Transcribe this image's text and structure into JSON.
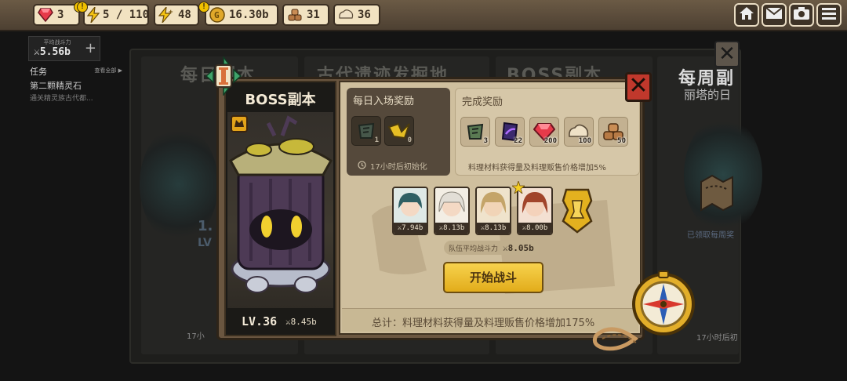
{
  "resources": [
    {
      "icon": "gem-icon",
      "value": "3",
      "alert": "!"
    },
    {
      "icon": "energy-icon",
      "value": "5 / 110",
      "alert": "!"
    },
    {
      "icon": "energy-plus-icon",
      "value": "48"
    },
    {
      "icon": "gold-coin-icon",
      "value": "16.30b",
      "alert": "!"
    },
    {
      "icon": "wood-icon",
      "value": "31"
    },
    {
      "icon": "stone-icon",
      "value": "36"
    }
  ],
  "top_buttons": [
    "home-icon",
    "mail-icon",
    "camera-icon",
    "menu-icon"
  ],
  "sidebar": {
    "power_label": "平均战斗力",
    "power_value": "⚔5.56b",
    "plus": "+",
    "quest_title": "任务",
    "quest_all": "查看全部 ▶",
    "quest_name": "第二颗精灵石",
    "quest_desc": "通关精灵族古代都..."
  },
  "background": {
    "tabs": [
      "每日副本",
      "古代遗迹发掘地",
      "BOSS副本"
    ],
    "weekly_title": "每周副",
    "weekly_sub": "丽塔的日",
    "level_text": "1.",
    "level_text2": "LV",
    "timer_left": "17小",
    "timer_right": "17小时后初",
    "claimed": "已领取每周奖"
  },
  "modal": {
    "boss_title": "BOSS副本",
    "boss_level": "LV.36",
    "boss_power": "⚔8.45b",
    "daily_title": "每日入场奖励",
    "daily_items": [
      {
        "icon": "leaf-scroll-icon",
        "count": "1"
      },
      {
        "icon": "gold-ticket-icon",
        "count": "0"
      }
    ],
    "daily_timer": "17小时后初始化",
    "finish_title": "完成奖励",
    "finish_items": [
      {
        "icon": "leaf-scroll-icon",
        "count": "3"
      },
      {
        "icon": "purple-crystal-icon",
        "count": "22"
      },
      {
        "icon": "red-gem-icon",
        "count": "200"
      },
      {
        "icon": "stone-icon",
        "count": "100"
      },
      {
        "icon": "wood-icon",
        "count": "50"
      }
    ],
    "finish_note": "料理材料获得量及料理贩售价格增加5%",
    "heroes": [
      {
        "power": "⚔7.94b",
        "hair": "#2f5f63",
        "skin": "#f4d9c4"
      },
      {
        "power": "⚔8.13b",
        "hair": "#e9e6e0",
        "skin": "#f4d9c4"
      },
      {
        "power": "⚔8.13b",
        "hair": "#c4a469",
        "skin": "#f1d4b7"
      },
      {
        "power": "⚔8.00b",
        "hair": "#a1442a",
        "skin": "#f4d2bb"
      }
    ],
    "team_power_label": "队伍平均战斗力",
    "team_power_value": "⚔8.05b",
    "start_button": "开始战斗",
    "total_text": "总计：料理材料获得量及料理贩售价格增加175%"
  },
  "colors": {
    "accent": "#f0c000",
    "start_button": "#f3c93a",
    "close_red": "#c0382c"
  }
}
